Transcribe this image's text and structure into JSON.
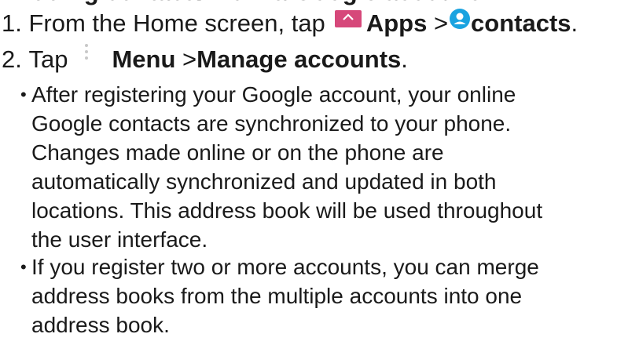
{
  "partial_heading": "Adding contacts from a Google account",
  "steps": [
    {
      "number": "1.",
      "prefix": "From the Home screen, tap",
      "apps_label": "Apps",
      "separator": ">",
      "contacts_label": "contacts",
      "suffix": "."
    },
    {
      "number": "2.",
      "prefix": "Tap",
      "menu_label": "Menu",
      "separator": ">",
      "manage_label": "Manage accounts",
      "suffix": "."
    }
  ],
  "bullets": [
    {
      "marker": "•",
      "lines": [
        "After registering your Google account, your online",
        "Google contacts are synchronized to your phone.",
        "Changes made online or on the phone are",
        "automatically synchronized and updated in both",
        "locations. This address book will be used throughout",
        "the user interface."
      ]
    },
    {
      "marker": "•",
      "lines": [
        "If you register two or more accounts, you can merge",
        "address books from the multiple accounts into one",
        "address book."
      ]
    }
  ],
  "icons": {
    "apps": "apps-icon",
    "contacts": "contacts-icon",
    "menu": "menu-icon"
  },
  "colors": {
    "apps_icon_bg": "#d6487a",
    "contacts_icon_bg": "#19a3e0",
    "text": "#1a1a1a"
  }
}
